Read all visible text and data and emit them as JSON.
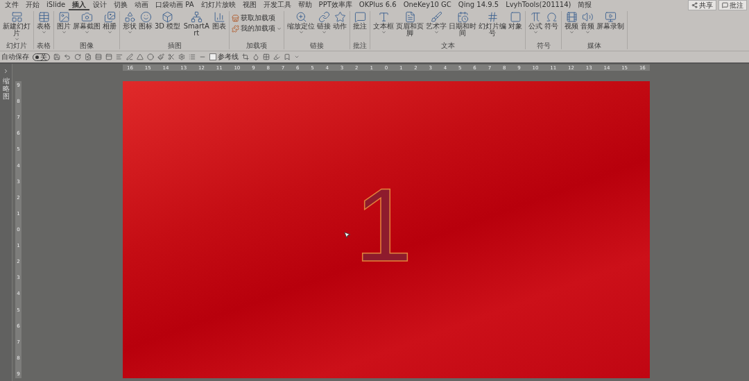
{
  "tabs": [
    {
      "label": "文件",
      "selected": false
    },
    {
      "label": "开始",
      "selected": false
    },
    {
      "label": "iSlide",
      "selected": false
    },
    {
      "label": "插入",
      "selected": true
    },
    {
      "label": "设计",
      "selected": false
    },
    {
      "label": "切换",
      "selected": false
    },
    {
      "label": "动画",
      "selected": false
    },
    {
      "label": "口袋动画 PA",
      "selected": false
    },
    {
      "label": "幻灯片放映",
      "selected": false
    },
    {
      "label": "视图",
      "selected": false
    },
    {
      "label": "开发工具",
      "selected": false
    },
    {
      "label": "帮助",
      "selected": false
    },
    {
      "label": "PPT效率库",
      "selected": false
    },
    {
      "label": "OKPlus 6.6",
      "selected": false
    },
    {
      "label": "OneKey10 GC",
      "selected": false
    },
    {
      "label": "Qing 14.9.5",
      "selected": false
    },
    {
      "label": "LvyhTools(201114)",
      "selected": false
    },
    {
      "label": "简报",
      "selected": false
    }
  ],
  "header_buttons": [
    {
      "label": "共享",
      "kind": "share"
    },
    {
      "label": "批注",
      "kind": "comment"
    }
  ],
  "ribbon": {
    "groups": [
      {
        "label": "幻灯片",
        "items": [
          {
            "label": "新建幻灯片",
            "kind": "large",
            "dropdown": true
          }
        ]
      },
      {
        "label": "表格",
        "items": [
          {
            "label": "表格",
            "kind": "large",
            "dropdown": true
          }
        ]
      },
      {
        "label": "图像",
        "items": [
          {
            "label": "图片",
            "kind": "large",
            "dropdown": true
          },
          {
            "label": "屏幕截图",
            "kind": "large",
            "dropdown": true
          },
          {
            "label": "相册",
            "kind": "large",
            "dropdown": true
          }
        ]
      },
      {
        "label": "插图",
        "items": [
          {
            "label": "形状",
            "kind": "large",
            "dropdown": true
          },
          {
            "label": "图标",
            "kind": "large",
            "dropdown": false
          },
          {
            "label": "3D 模型",
            "kind": "large",
            "dropdown": false
          },
          {
            "label": "SmartArt",
            "kind": "large",
            "dropdown": false
          },
          {
            "label": "图表",
            "kind": "large",
            "dropdown": false
          }
        ]
      },
      {
        "label": "加载项",
        "items": [
          {
            "label": "获取加载项",
            "kind": "small",
            "dropdown": false
          },
          {
            "label": "我的加载项",
            "kind": "small",
            "dropdown": true
          }
        ]
      },
      {
        "label": "链接",
        "items": [
          {
            "label": "缩放定位",
            "kind": "large",
            "dropdown": true
          },
          {
            "label": "链接",
            "kind": "large",
            "dropdown": true
          },
          {
            "label": "动作",
            "kind": "large",
            "dropdown": false
          }
        ]
      },
      {
        "label": "批注",
        "items": [
          {
            "label": "批注",
            "kind": "large",
            "dropdown": false
          }
        ]
      },
      {
        "label": "文本",
        "items": [
          {
            "label": "文本框",
            "kind": "large",
            "dropdown": true
          },
          {
            "label": "页眉和页脚",
            "kind": "large",
            "dropdown": false
          },
          {
            "label": "艺术字",
            "kind": "large",
            "dropdown": true
          },
          {
            "label": "日期和时间",
            "kind": "large",
            "dropdown": false
          },
          {
            "label": "幻灯片编号",
            "kind": "large",
            "dropdown": false
          },
          {
            "label": "对象",
            "kind": "large",
            "dropdown": false
          }
        ]
      },
      {
        "label": "符号",
        "items": [
          {
            "label": "公式",
            "kind": "large",
            "dropdown": true
          },
          {
            "label": "符号",
            "kind": "large",
            "dropdown": false
          }
        ]
      },
      {
        "label": "媒体",
        "items": [
          {
            "label": "视频",
            "kind": "large",
            "dropdown": true
          },
          {
            "label": "音频",
            "kind": "large",
            "dropdown": true
          },
          {
            "label": "屏幕录制",
            "kind": "large",
            "dropdown": false
          }
        ]
      }
    ]
  },
  "quick_access": {
    "autosave": {
      "label": "自动保存",
      "state_text": "关",
      "on": false
    },
    "guides": {
      "label": "参考线",
      "checked": false
    }
  },
  "thumbnail_pane": {
    "label": "缩略图"
  },
  "horizontal_ruler": [
    "16",
    "15",
    "14",
    "13",
    "12",
    "11",
    "10",
    "9",
    "8",
    "7",
    "6",
    "5",
    "4",
    "3",
    "2",
    "1",
    "0",
    "1",
    "2",
    "3",
    "4",
    "5",
    "6",
    "7",
    "8",
    "9",
    "10",
    "11",
    "12",
    "13",
    "14",
    "15",
    "16"
  ],
  "vertical_ruler": [
    "9",
    "8",
    "7",
    "6",
    "5",
    "4",
    "3",
    "2",
    "1",
    "0",
    "1",
    "2",
    "3",
    "4",
    "5",
    "6",
    "7",
    "8",
    "9"
  ],
  "slide": {
    "text": "1"
  }
}
